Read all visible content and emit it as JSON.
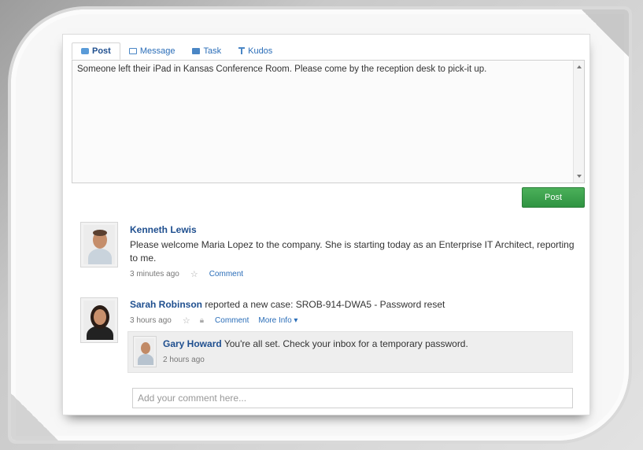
{
  "composer": {
    "tabs": [
      {
        "label": "Post",
        "icon": "post-icon",
        "active": true
      },
      {
        "label": "Message",
        "icon": "message-icon",
        "active": false
      },
      {
        "label": "Task",
        "icon": "task-icon",
        "active": false
      },
      {
        "label": "Kudos",
        "icon": "kudos-icon",
        "active": false
      }
    ],
    "text": "Someone left their iPad in Kansas Conference Room. Please come by the reception desk to pick-it up.",
    "post_button": "Post"
  },
  "feed": [
    {
      "name": "Kenneth Lewis",
      "text": "Please welcome Maria Lopez to the company. She is starting today as an Enterprise IT Architect, reporting to me.",
      "time": "3 minutes ago",
      "comment_link": "Comment"
    },
    {
      "name": "Sarah Robinson",
      "text": " reported a new case: SROB-914-DWA5 - Password reset",
      "time": "3 hours ago",
      "comment_link": "Comment",
      "more_link": "More Info ▾",
      "reply": {
        "name": "Gary Howard",
        "text": " You're all set. Check your inbox for a temporary password.",
        "time": "2 hours ago"
      },
      "comment_placeholder": "Add your comment here..."
    }
  ],
  "colors": {
    "link": "#2a6db8",
    "name": "#1f4f8f",
    "post_button": "#34994a"
  }
}
